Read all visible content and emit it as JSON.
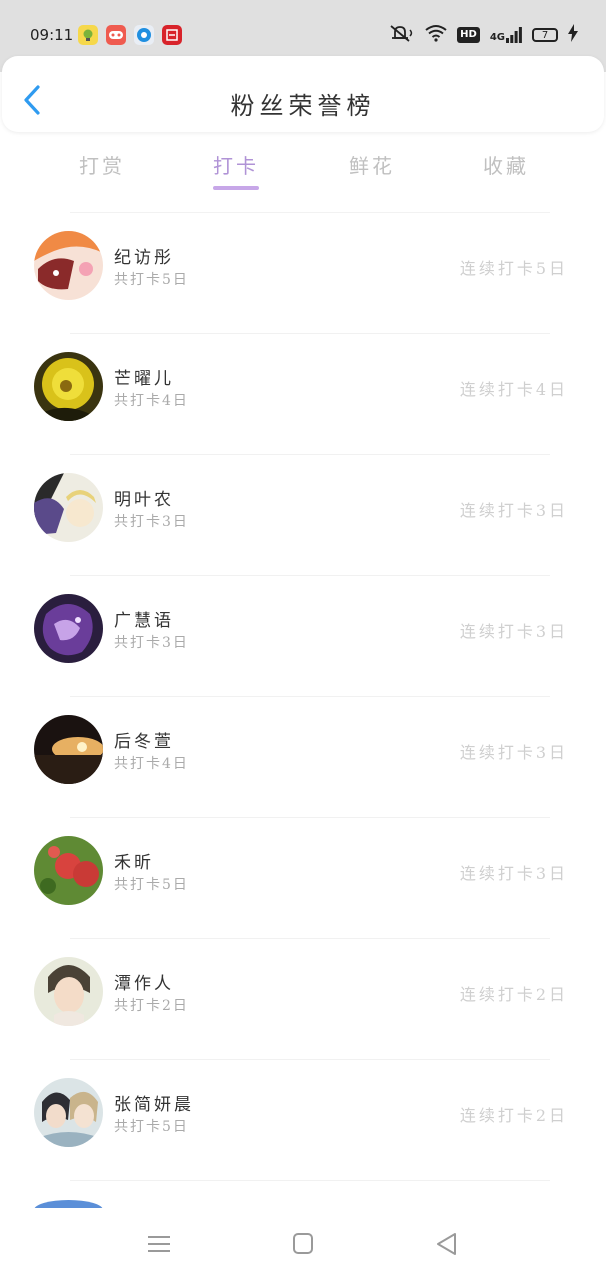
{
  "status_bar": {
    "time": "09:11",
    "network": "4G",
    "hd": "HD",
    "battery": "7"
  },
  "header": {
    "title": "粉丝荣誉榜",
    "back_icon": "chevron-left-icon"
  },
  "tabs": [
    {
      "label": "打赏",
      "active": false
    },
    {
      "label": "打卡",
      "active": true
    },
    {
      "label": "鲜花",
      "active": false
    },
    {
      "label": "收藏",
      "active": false
    }
  ],
  "fans": [
    {
      "name": "纪访彤",
      "total": "共打卡5日",
      "streak": "连续打卡5日"
    },
    {
      "name": "芒曜儿",
      "total": "共打卡4日",
      "streak": "连续打卡4日"
    },
    {
      "name": "明叶农",
      "total": "共打卡3日",
      "streak": "连续打卡3日"
    },
    {
      "name": "广慧语",
      "total": "共打卡3日",
      "streak": "连续打卡3日"
    },
    {
      "name": "后冬萱",
      "total": "共打卡4日",
      "streak": "连续打卡3日"
    },
    {
      "name": "禾昕",
      "total": "共打卡5日",
      "streak": "连续打卡3日"
    },
    {
      "name": "潭作人",
      "total": "共打卡2日",
      "streak": "连续打卡2日"
    },
    {
      "name": "张简妍晨",
      "total": "共打卡5日",
      "streak": "连续打卡2日"
    }
  ],
  "colors": {
    "accent": "#b093d6",
    "back_icon": "#2f9bf0",
    "muted": "#c0c0c0"
  },
  "nav": [
    "menu-icon",
    "home-square-icon",
    "back-triangle-icon"
  ]
}
